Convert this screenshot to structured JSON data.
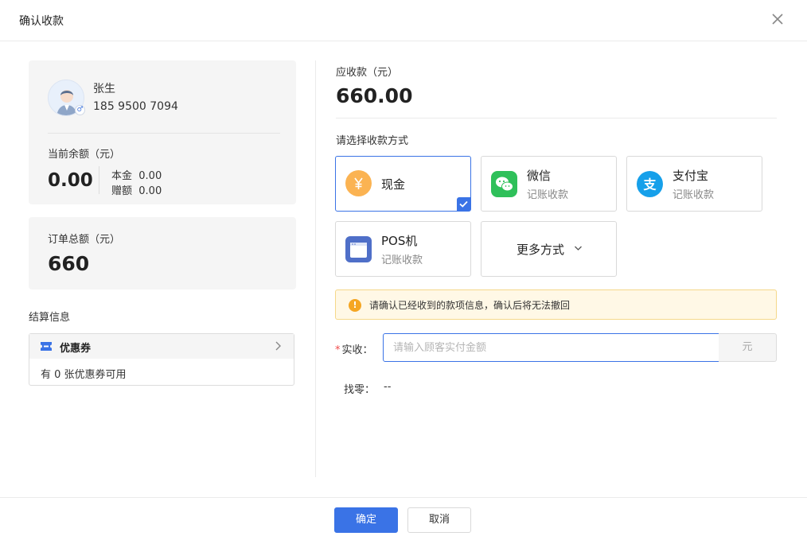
{
  "dialog": {
    "title": "确认收款"
  },
  "member": {
    "name": "张生",
    "phone": "185 9500 7094",
    "balance_label": "当前余额（元）",
    "balance_value": "0.00",
    "principal": "本金  0.00",
    "gift": "赠额  0.00"
  },
  "order": {
    "total_label": "订单总额（元）",
    "total_value": "660"
  },
  "settlement": {
    "title": "结算信息",
    "coupon_title": "优惠券",
    "coupon_available": "有 0 张优惠券可用"
  },
  "payment": {
    "due_label": "应收款（元）",
    "due_value": "660.00",
    "select_label": "请选择收款方式",
    "methods": [
      {
        "name": "现金",
        "sub": ""
      },
      {
        "name": "微信",
        "sub": "记账收款"
      },
      {
        "name": "支付宝",
        "sub": "记账收款"
      },
      {
        "name": "POS机",
        "sub": "记账收款"
      },
      {
        "name": "更多方式",
        "sub": ""
      }
    ],
    "notice": "请确认已经收到的款项信息，确认后将无法撤回",
    "actual_label": "实收：",
    "actual_required_mark": "*",
    "actual_placeholder": "请输入顾客实付金额",
    "actual_unit": "元",
    "change_label": "找零：",
    "change_value": "--"
  },
  "footer": {
    "confirm_label": "确定",
    "cancel_label": "取消"
  },
  "colors": {
    "primary": "#3a73e6",
    "cash": "#fbb352",
    "wechat": "#2fc05a",
    "alipay": "#16a0ea",
    "pos": "#4f6fc8",
    "warning": "#f5a623"
  }
}
